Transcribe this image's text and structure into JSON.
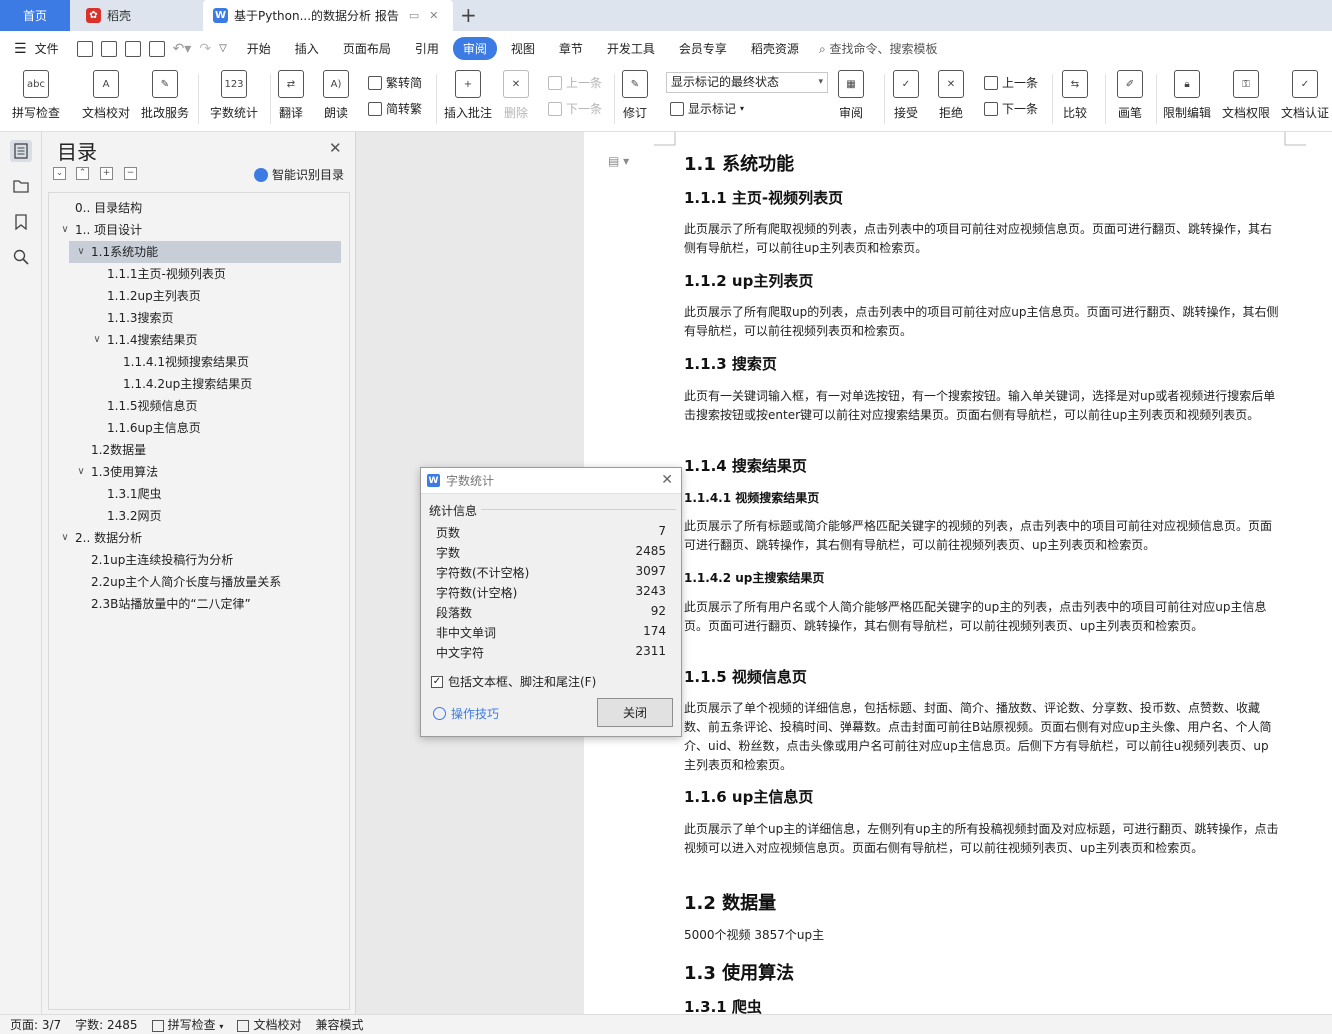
{
  "tabs": {
    "home": "首页",
    "daoke": "稻壳",
    "doc": "基于Python...的数据分析 报告"
  },
  "menu": {
    "file": "文件",
    "items": [
      "开始",
      "插入",
      "页面布局",
      "引用",
      "审阅",
      "视图",
      "章节",
      "开发工具",
      "会员专享",
      "稻壳资源"
    ],
    "active_index": 4,
    "search_placeholder": "查找命令、搜索模板"
  },
  "ribbon": {
    "spellcheck": "拼写检查",
    "doc_proof": "文档校对",
    "batch_service": "批改服务",
    "word_count": "字数统计",
    "translate": "翻译",
    "read_aloud": "朗读",
    "trad_simp": "繁转简",
    "simp_trad": "简转繁",
    "insert_comment": "插入批注",
    "delete": "删除",
    "prev_comment": "上一条",
    "next_comment": "下一条",
    "revise": "修订",
    "markup_state": "显示标记的最终状态",
    "show_markup": "显示标记",
    "review": "审阅",
    "accept": "接受",
    "reject": "拒绝",
    "prev_change": "上一条",
    "next_change": "下一条",
    "compare": "比较",
    "ink": "画笔",
    "restrict_edit": "限制编辑",
    "doc_permission": "文档权限",
    "doc_cert": "文档认证"
  },
  "toc": {
    "title": "目录",
    "smart_label": "智能识别目录",
    "items": [
      {
        "label": "0.. 目录结构",
        "level": 1,
        "caret": ""
      },
      {
        "label": "1.. 项目设计",
        "level": 1,
        "caret": "v"
      },
      {
        "label": "1.1系统功能",
        "level": 2,
        "caret": "v",
        "selected": true
      },
      {
        "label": "1.1.1主页-视频列表页",
        "level": 3,
        "caret": ""
      },
      {
        "label": "1.1.2up主列表页",
        "level": 3,
        "caret": ""
      },
      {
        "label": "1.1.3搜索页",
        "level": 3,
        "caret": ""
      },
      {
        "label": "1.1.4搜索结果页",
        "level": 3,
        "caret": "v"
      },
      {
        "label": "1.1.4.1视频搜索结果页",
        "level": 4,
        "caret": ""
      },
      {
        "label": "1.1.4.2up主搜索结果页",
        "level": 4,
        "caret": ""
      },
      {
        "label": "1.1.5视频信息页",
        "level": 3,
        "caret": ""
      },
      {
        "label": "1.1.6up主信息页",
        "level": 3,
        "caret": ""
      },
      {
        "label": "1.2数据量",
        "level": 2,
        "caret": ""
      },
      {
        "label": "1.3使用算法",
        "level": 2,
        "caret": "v"
      },
      {
        "label": "1.3.1爬虫",
        "level": 3,
        "caret": ""
      },
      {
        "label": "1.3.2网页",
        "level": 3,
        "caret": ""
      },
      {
        "label": "2.. 数据分析",
        "level": 1,
        "caret": "v"
      },
      {
        "label": "2.1up主连续投稿行为分析",
        "level": 2,
        "caret": ""
      },
      {
        "label": "2.2up主个人简介长度与播放量关系",
        "level": 2,
        "caret": ""
      },
      {
        "label": "2.3B站播放量中的“二八定律”",
        "level": 2,
        "caret": ""
      }
    ]
  },
  "doc": {
    "h_1_1": "1.1 系统功能",
    "h_1_1_1": "1.1.1 主页-视频列表页",
    "p_1_1_1": "此页展示了所有爬取视频的列表，点击列表中的项目可前往对应视频信息页。页面可进行翻页、跳转操作，其右侧有导航栏，可以前往up主列表页和检索页。",
    "h_1_1_2": "1.1.2 up主列表页",
    "p_1_1_2": "此页展示了所有爬取up的列表，点击列表中的项目可前往对应up主信息页。页面可进行翻页、跳转操作，其右侧有导航栏，可以前往视频列表页和检索页。",
    "h_1_1_3": "1.1.3 搜索页",
    "p_1_1_3": "此页有一关键词输入框，有一对单选按钮，有一个搜索按钮。输入单关键词，选择是对up或者视频进行搜索后单击搜索按钮或按enter键可以前往对应搜索结果页。页面右侧有导航栏，可以前往up主列表页和视频列表页。",
    "h_1_1_4": "1.1.4 搜索结果页",
    "h_1_1_4_1": "1.1.4.1 视频搜索结果页",
    "p_1_1_4_1": "此页展示了所有标题或简介能够严格匹配关键字的视频的列表，点击列表中的项目可前往对应视频信息页。页面可进行翻页、跳转操作，其右侧有导航栏，可以前往视频列表页、up主列表页和检索页。",
    "h_1_1_4_2": "1.1.4.2 up主搜索结果页",
    "p_1_1_4_2": "此页展示了所有用户名或个人简介能够严格匹配关键字的up主的列表，点击列表中的项目可前往对应up主信息页。页面可进行翻页、跳转操作，其右侧有导航栏，可以前往视频列表页、up主列表页和检索页。",
    "h_1_1_5": "1.1.5 视频信息页",
    "p_1_1_5": "此页展示了单个视频的详细信息，包括标题、封面、简介、播放数、评论数、分享数、投币数、点赞数、收藏数、前五条评论、投稿时间、弹幕数。点击封面可前往B站原视频。页面右侧有对应up主头像、用户名、个人简介、uid、粉丝数，点击头像或用户名可前往对应up主信息页。后侧下方有导航栏，可以前往u视频列表页、up主列表页和检索页。",
    "h_1_1_6": "1.1.6 up主信息页",
    "p_1_1_6": "此页展示了单个up主的详细信息，左侧列有up主的所有投稿视频封面及对应标题，可进行翻页、跳转操作，点击视频可以进入对应视频信息页。页面右侧有导航栏，可以前往视频列表页、up主列表页和检索页。",
    "h_1_2": "1.2 数据量",
    "p_1_2": "5000个视频 3857个up主",
    "h_1_3": "1.3 使用算法",
    "h_1_3_1": "1.3.1 爬虫"
  },
  "dialog": {
    "title": "字数统计",
    "section": "统计信息",
    "stats": [
      {
        "label": "页数",
        "value": "7"
      },
      {
        "label": "字数",
        "value": "2485"
      },
      {
        "label": "字符数(不计空格)",
        "value": "3097"
      },
      {
        "label": "字符数(计空格)",
        "value": "3243"
      },
      {
        "label": "段落数",
        "value": "92"
      },
      {
        "label": "非中文单词",
        "value": "174"
      },
      {
        "label": "中文字符",
        "value": "2311"
      }
    ],
    "include_label": "包括文本框、脚注和尾注(F)",
    "include_checked": true,
    "tips": "操作技巧",
    "close": "关闭"
  },
  "status": {
    "page": "页面: 3/7",
    "words": "字数: 2485",
    "spell": "拼写检查",
    "proof": "文档校对",
    "compat": "兼容模式"
  },
  "colors": {
    "accent": "#3d7be4"
  }
}
